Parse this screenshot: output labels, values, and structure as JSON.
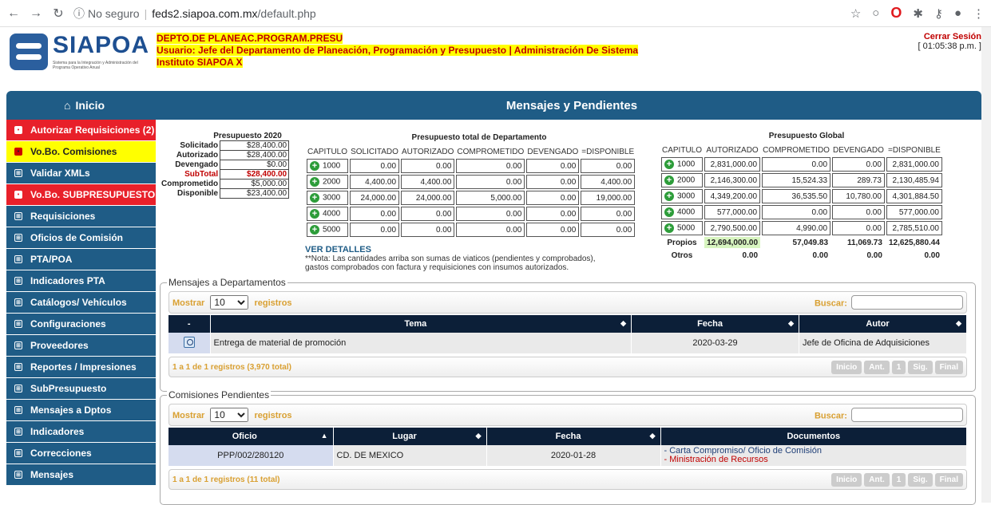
{
  "browser": {
    "security": "No seguro",
    "url_host": "feds2.siapoa.com.mx",
    "url_path": "/default.php"
  },
  "header": {
    "logo_word": "SIAPOA",
    "logo_tagline": "Sistema para la Integración y Administración del Programa Operativo Anual",
    "line1": "DEPTO.DE PLANEAC.PROGRAM.PRESU",
    "line2": "Usuario: Jefe del Departamento de Planeación, Programación y Presupuesto | Administración De Sistema",
    "line3": "Instituto SIAPOA X",
    "logout": "Cerrar Sesión",
    "time": "[ 01:05:38 p.m. ]"
  },
  "titlebar": {
    "home": "Inicio",
    "title": "Mensajes y Pendientes"
  },
  "sidebar": {
    "items": [
      {
        "label": "Autorizar Requisiciones (2)",
        "style": "red"
      },
      {
        "label": "Vo.Bo. Comisiones",
        "style": "yellow"
      },
      {
        "label": "Validar XMLs",
        "style": "blue"
      },
      {
        "label": "Vo.Bo. SUBPRESUPUESTO",
        "style": "red"
      },
      {
        "label": "Requisiciones",
        "style": "blue"
      },
      {
        "label": "Oficios de Comisión",
        "style": "blue"
      },
      {
        "label": "PTA/POA",
        "style": "blue"
      },
      {
        "label": "Indicadores PTA",
        "style": "blue"
      },
      {
        "label": "Catálogos/ Vehículos",
        "style": "blue"
      },
      {
        "label": "Configuraciones",
        "style": "blue"
      },
      {
        "label": "Proveedores",
        "style": "blue"
      },
      {
        "label": "Reportes / Impresiones",
        "style": "blue"
      },
      {
        "label": "SubPresupuesto",
        "style": "blue"
      },
      {
        "label": "Mensajes a Dptos",
        "style": "blue"
      },
      {
        "label": "Indicadores",
        "style": "blue"
      },
      {
        "label": "Correcciones",
        "style": "blue"
      },
      {
        "label": "Mensajes",
        "style": "blue"
      }
    ]
  },
  "budget2020": {
    "title": "Presupuesto 2020",
    "rows": [
      {
        "label": "Solicitado",
        "value": "$28,400.00"
      },
      {
        "label": "Autorizado",
        "value": "$28,400.00"
      },
      {
        "label": "Devengado",
        "value": "$0.00"
      },
      {
        "label": "SubTotal",
        "value": "$28,400.00"
      },
      {
        "label": "Comprometido",
        "value": "$5,000.00"
      },
      {
        "label": "Disponible",
        "value": "$23,400.00"
      }
    ]
  },
  "dept_budget": {
    "title": "Presupuesto total de Departamento",
    "headers": [
      "CAPITULO",
      "SOLICITADO",
      "AUTORIZADO",
      "COMPROMETIDO",
      "DEVENGADO",
      "=DISPONIBLE"
    ],
    "rows": [
      [
        "1000",
        "0.00",
        "0.00",
        "0.00",
        "0.00",
        "0.00"
      ],
      [
        "2000",
        "4,400.00",
        "4,400.00",
        "0.00",
        "0.00",
        "4,400.00"
      ],
      [
        "3000",
        "24,000.00",
        "24,000.00",
        "5,000.00",
        "0.00",
        "19,000.00"
      ],
      [
        "4000",
        "0.00",
        "0.00",
        "0.00",
        "0.00",
        "0.00"
      ],
      [
        "5000",
        "0.00",
        "0.00",
        "0.00",
        "0.00",
        "0.00"
      ]
    ],
    "details_link": "VER DETALLES",
    "note": "**Nota: Las cantidades arriba son sumas de viaticos (pendientes y comprobados), gastos comprobados con factura y requisiciones con insumos autorizados."
  },
  "global_budget": {
    "title": "Presupuesto Global",
    "headers": [
      "CAPITULO",
      "AUTORIZADO",
      "COMPROMETIDO",
      "DEVENGADO",
      "=DISPONIBLE"
    ],
    "rows": [
      [
        "1000",
        "2,831,000.00",
        "0.00",
        "0.00",
        "2,831,000.00"
      ],
      [
        "2000",
        "2,146,300.00",
        "15,524.33",
        "289.73",
        "2,130,485.94"
      ],
      [
        "3000",
        "4,349,200.00",
        "36,535.50",
        "10,780.00",
        "4,301,884.50"
      ],
      [
        "4000",
        "577,000.00",
        "0.00",
        "0.00",
        "577,000.00"
      ],
      [
        "5000",
        "2,790,500.00",
        "4,990.00",
        "0.00",
        "2,785,510.00"
      ]
    ],
    "totals": [
      [
        "Propios",
        "12,694,000.00",
        "57,049.83",
        "11,069.73",
        "12,625,880.44"
      ],
      [
        "Otros",
        "0.00",
        "0.00",
        "0.00",
        "0.00"
      ]
    ]
  },
  "messages_panel": {
    "legend": "Mensajes a Departamentos",
    "show_label": "Mostrar",
    "records_label": "registros",
    "page_size": "10",
    "search_label": "Buscar:",
    "columns": [
      "-",
      "Tema",
      "Fecha",
      "Autor"
    ],
    "rows": [
      {
        "tema": "Entrega de material de promoción",
        "fecha": "2020-03-29",
        "autor": "Jefe de Oficina de Adquisiciones"
      }
    ],
    "info": "1 a 1 de 1 registros (3,970 total)",
    "pager": [
      "Inicio",
      "Ant.",
      "1",
      "Sig.",
      "Final"
    ]
  },
  "commissions_panel": {
    "legend": "Comisiones Pendientes",
    "show_label": "Mostrar",
    "records_label": "registros",
    "page_size": "10",
    "search_label": "Buscar:",
    "columns": [
      "Oficio",
      "Lugar",
      "Fecha",
      "Documentos"
    ],
    "rows": [
      {
        "oficio": "PPP/002/280120",
        "lugar": "CD. DE MEXICO",
        "fecha": "2020-01-28",
        "doc1": "- Carta Compromiso/ Oficio de Comisión",
        "doc2": "- Ministración de Recursos"
      }
    ],
    "info": "1 a 1 de 1 registros (11 total)",
    "pager": [
      "Inicio",
      "Ant.",
      "1",
      "Sig.",
      "Final"
    ]
  }
}
